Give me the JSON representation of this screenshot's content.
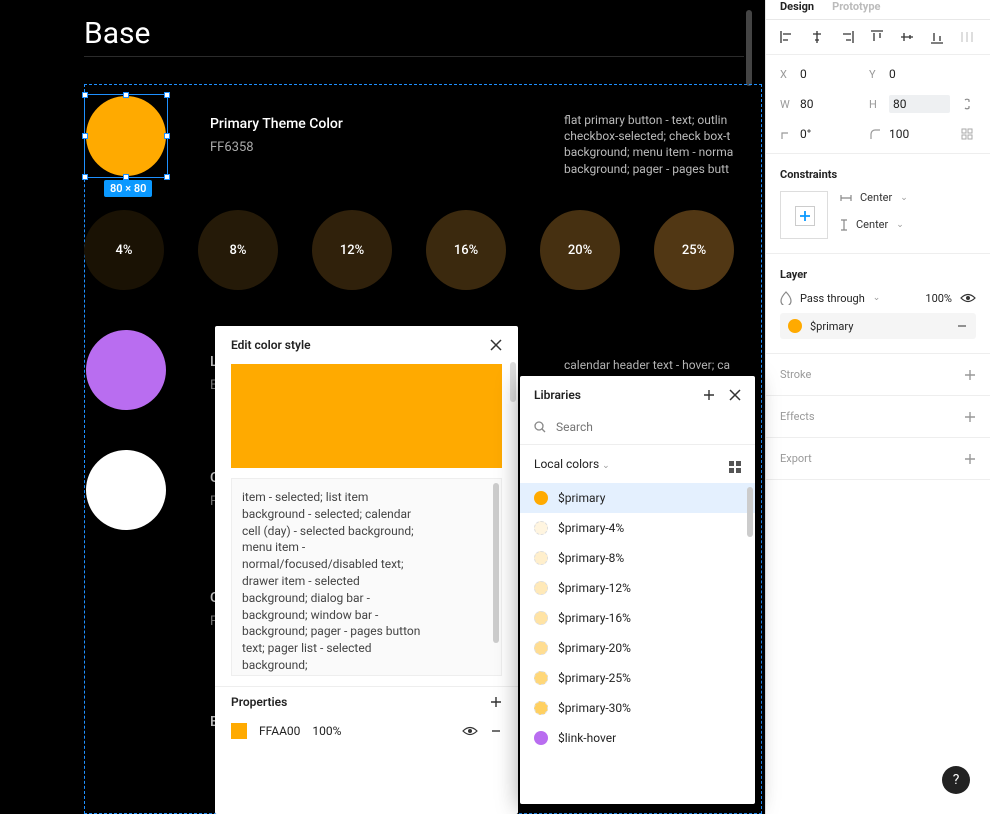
{
  "canvas": {
    "page_title": "Base",
    "selection_badge": "80 × 80",
    "primary": {
      "label": "Primary Theme Color",
      "hex": "FF6358",
      "usage": "flat primary button - text; outlin\ncheckbox-selected; check box-t\nbackground; menu item - norma\nbackground; pager - pages butt"
    },
    "tints": [
      "4%",
      "8%",
      "12%",
      "16%",
      "20%",
      "25%"
    ],
    "tint_colors": [
      "#1a1204",
      "#251a08",
      "#30210b",
      "#3b290e",
      "#463011",
      "#513714"
    ],
    "link_hover_peek": {
      "label_initial": "L",
      "hex_initial": "E",
      "usage": "calendar header text - hover; ca"
    },
    "swatch2_peek": {
      "label_initial": "C",
      "hex_initial": "F"
    },
    "row4_peek": {
      "label_initial": "C",
      "hex_initial": "F"
    },
    "row5_peek": {
      "label_initial": "E"
    }
  },
  "edit_popover": {
    "title": "Edit color style",
    "chip_color": "#FFAA00",
    "description": "item - selected; list item background - selected; calendar cell (day) - selected background; menu item - normal/focused/disabled text; drawer item - selected background; dialog bar - background; window bar - background; pager - pages button text; pager list - selected background;",
    "properties_title": "Properties",
    "hex": "FFAA00",
    "opacity": "100%"
  },
  "libraries_popover": {
    "title": "Libraries",
    "search_placeholder": "Search",
    "group_label": "Local colors",
    "items": [
      {
        "name": "$primary",
        "color": "#FFAA00",
        "selected": true
      },
      {
        "name": "$primary-4%",
        "color": "#fff5e0"
      },
      {
        "name": "$primary-8%",
        "color": "#ffefcc"
      },
      {
        "name": "$primary-12%",
        "color": "#ffe9b8"
      },
      {
        "name": "$primary-16%",
        "color": "#ffe3a4"
      },
      {
        "name": "$primary-20%",
        "color": "#ffdd91"
      },
      {
        "name": "$primary-25%",
        "color": "#ffd778"
      },
      {
        "name": "$primary-30%",
        "color": "#ffd060"
      },
      {
        "name": "$link-hover",
        "color": "#b96df0"
      }
    ]
  },
  "inspector": {
    "tabs": {
      "design": "Design",
      "prototype": "Prototype"
    },
    "coords": {
      "x_label": "X",
      "x": "0",
      "y_label": "Y",
      "y": "0",
      "w_label": "W",
      "w": "80",
      "h_label": "H",
      "h": "80",
      "rot": "0°",
      "radius": "100"
    },
    "constraints": {
      "title": "Constraints",
      "h": "Center",
      "v": "Center"
    },
    "layer": {
      "title": "Layer",
      "blend": "Pass through",
      "opacity": "100%"
    },
    "fill": {
      "label": "$primary",
      "color": "#FFAA00"
    },
    "stroke": "Stroke",
    "effects": "Effects",
    "export": "Export"
  },
  "help_label": "?"
}
